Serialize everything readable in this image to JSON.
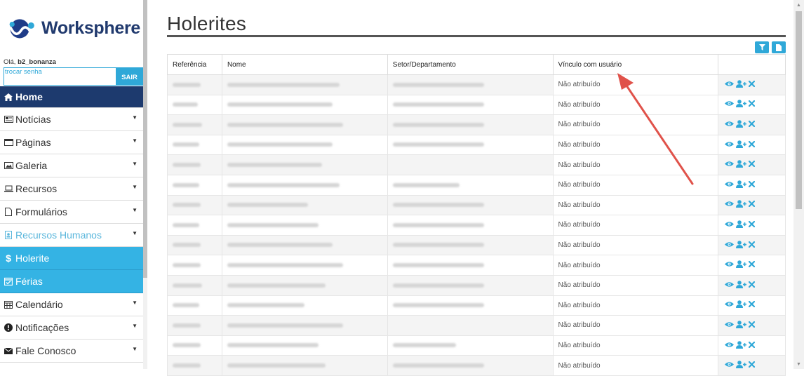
{
  "brand": {
    "name": "Worksphere",
    "logo_colors": [
      "#1f3c88",
      "#2fa8d8"
    ]
  },
  "user": {
    "greeting_prefix": "Olá, ",
    "username": "b2_bonanza",
    "change_password": "trocar senha",
    "logout": "SAIR"
  },
  "menu": {
    "home": "Home",
    "noticias": "Notícias",
    "paginas": "Páginas",
    "galeria": "Galeria",
    "recursos": "Recursos",
    "formularios": "Formulários",
    "recursos_humanos": "Recursos Humanos",
    "holerite": "Holerite",
    "ferias": "Férias",
    "calendario": "Calendário",
    "notificacoes": "Notificações",
    "fale_conosco": "Fale Conosco"
  },
  "page": {
    "title": "Holerites"
  },
  "toolbar": {
    "filter_icon": "filter-icon",
    "export_icon": "document-icon"
  },
  "table": {
    "headers": [
      "Referência",
      "Nome",
      "Setor/Departamento",
      "Vínculo com usuário",
      ""
    ],
    "rows": [
      {
        "status": "Não atribuído"
      },
      {
        "status": "Não atribuído"
      },
      {
        "status": "Não atribuído"
      },
      {
        "status": "Não atribuído"
      },
      {
        "status": "Não atribuído"
      },
      {
        "status": "Não atribuído"
      },
      {
        "status": "Não atribuído"
      },
      {
        "status": "Não atribuído"
      },
      {
        "status": "Não atribuído"
      },
      {
        "status": "Não atribuído"
      },
      {
        "status": "Não atribuído"
      },
      {
        "status": "Não atribuído"
      },
      {
        "status": "Não atribuído"
      },
      {
        "status": "Não atribuído"
      },
      {
        "status": "Não atribuído"
      }
    ],
    "row_actions": [
      "eye-icon",
      "user-plus-icon",
      "close-icon"
    ]
  },
  "colors": {
    "accent": "#2fa8d8",
    "navy": "#1d3a6e",
    "annotation_arrow": "#e0524a"
  }
}
